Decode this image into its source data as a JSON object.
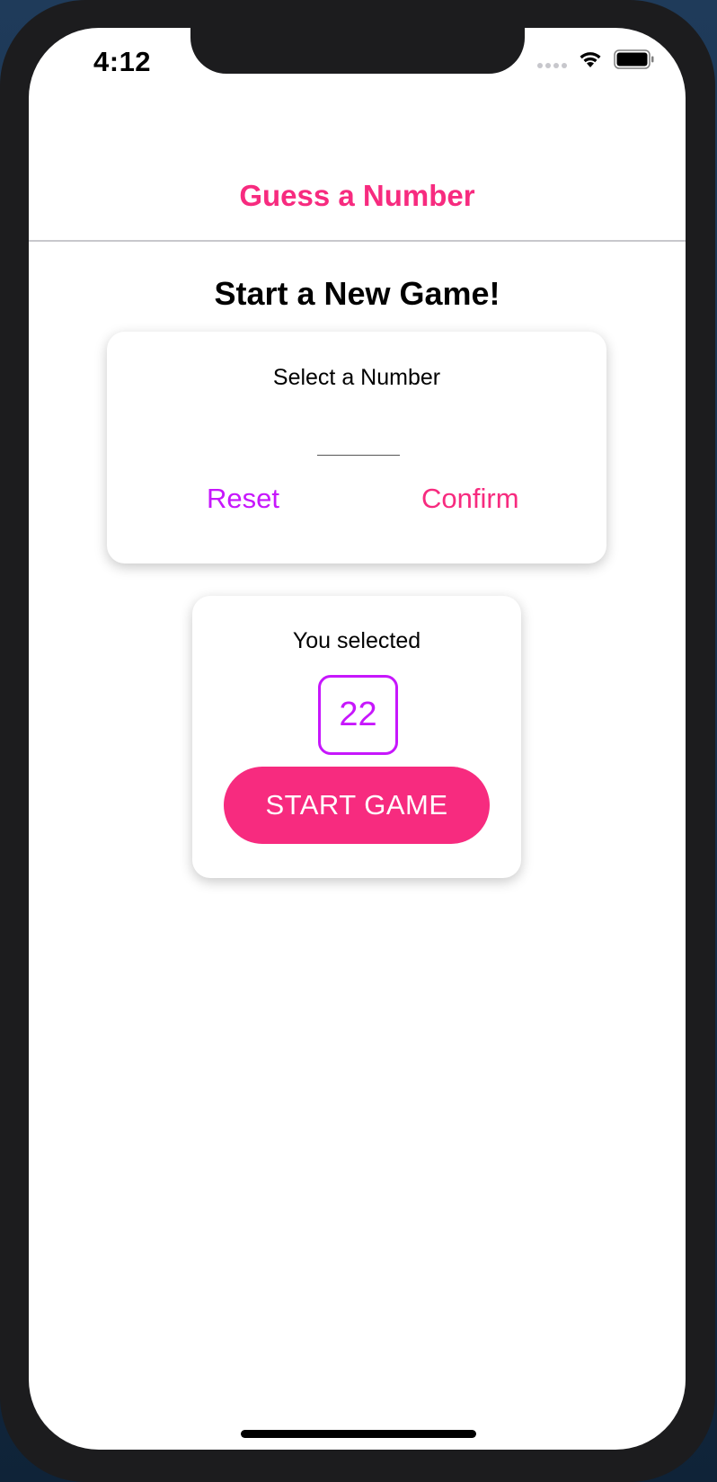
{
  "status_bar": {
    "time": "4:12"
  },
  "header": {
    "title": "Guess a Number"
  },
  "main": {
    "title": "Start a New Game!"
  },
  "input_card": {
    "label": "Select a Number",
    "input_value": "",
    "reset_label": "Reset",
    "confirm_label": "Confirm"
  },
  "summary_card": {
    "label": "You selected",
    "selected_number": "22",
    "start_label": "START GAME"
  },
  "colors": {
    "primary": "#f72b7f",
    "accent": "#c717fc"
  },
  "icons": [
    "cellular-signal-icon",
    "wifi-icon",
    "battery-icon"
  ]
}
